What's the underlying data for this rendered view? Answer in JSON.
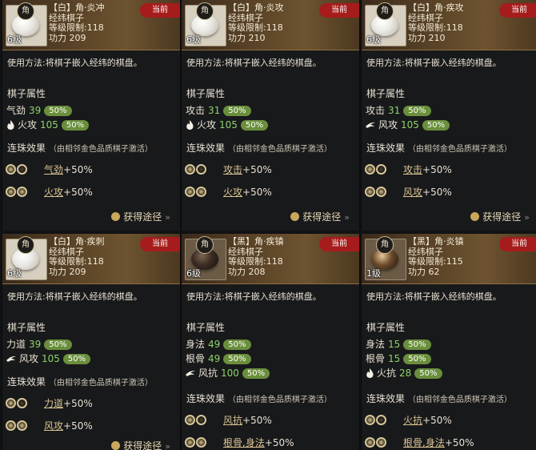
{
  "cards": [
    {
      "tag": "角",
      "level": "6级",
      "name": "【白】角·炎冲",
      "type": "经纬棋子",
      "level_limit": "等级限制:118",
      "power": "功力 209",
      "current": "当前",
      "usage": "使用方法:将棋子嵌入经纬的棋盘。",
      "attr_title": "棋子属性",
      "attrs": [
        {
          "name": "气劲",
          "value": "39",
          "pct": "50%",
          "icon": "none"
        },
        {
          "name": "火攻",
          "value": "105",
          "pct": "50%",
          "icon": "fire-icon"
        }
      ],
      "chain_title": "连珠效果",
      "chain_note": "（由相邻金色品质棋子激活）",
      "chains": [
        {
          "key": "气劲",
          "text": "+50%"
        },
        {
          "key": "火攻",
          "text": "+50%"
        }
      ],
      "get": "获得途径"
    },
    {
      "tag": "角",
      "level": "6级",
      "name": "【白】角·炎攻",
      "type": "经纬棋子",
      "level_limit": "等级限制:118",
      "power": "功力 210",
      "current": "当前",
      "usage": "使用方法:将棋子嵌入经纬的棋盘。",
      "attr_title": "棋子属性",
      "attrs": [
        {
          "name": "攻击",
          "value": "31",
          "pct": "50%",
          "icon": "none"
        },
        {
          "name": "火攻",
          "value": "105",
          "pct": "50%",
          "icon": "fire-icon"
        }
      ],
      "chain_title": "连珠效果",
      "chain_note": "（由相邻金色品质棋子激活）",
      "chains": [
        {
          "key": "攻击",
          "text": "+50%"
        },
        {
          "key": "火攻",
          "text": "+50%"
        }
      ],
      "get": "获得途径"
    },
    {
      "tag": "角",
      "level": "6级",
      "name": "【白】角·疾攻",
      "type": "经纬棋子",
      "level_limit": "等级限制:118",
      "power": "功力 210",
      "current": "当前",
      "usage": "使用方法:将棋子嵌入经纬的棋盘。",
      "attr_title": "棋子属性",
      "attrs": [
        {
          "name": "攻击",
          "value": "31",
          "pct": "50%",
          "icon": "none"
        },
        {
          "name": "风攻",
          "value": "105",
          "pct": "50%",
          "icon": "wind-icon"
        }
      ],
      "chain_title": "连珠效果",
      "chain_note": "（由相邻金色品质棋子激活）",
      "chains": [
        {
          "key": "攻击",
          "text": "+50%"
        },
        {
          "key": "风攻",
          "text": "+50%"
        }
      ],
      "get": "获得途径"
    },
    {
      "tag": "角",
      "level": "6级",
      "name": "【白】角·疾刺",
      "type": "经纬棋子",
      "level_limit": "等级限制:118",
      "power": "功力 209",
      "current": "当前",
      "usage": "使用方法:将棋子嵌入经纬的棋盘。",
      "attr_title": "棋子属性",
      "attrs": [
        {
          "name": "力道",
          "value": "39",
          "pct": "50%",
          "icon": "none"
        },
        {
          "name": "风攻",
          "value": "105",
          "pct": "50%",
          "icon": "wind-icon"
        }
      ],
      "chain_title": "连珠效果",
      "chain_note": "（由相邻金色品质棋子激活）",
      "chains": [
        {
          "key": "力道",
          "text": "+50%"
        },
        {
          "key": "风攻",
          "text": "+50%"
        }
      ],
      "get": "获得途径"
    },
    {
      "tag": "角",
      "level": "6级",
      "name": "【黑】角·疾镇",
      "type": "经纬棋子",
      "level_limit": "等级限制:118",
      "power": "功力 208",
      "current": "当前",
      "usage": "使用方法:将棋子嵌入经纬的棋盘。",
      "attr_title": "棋子属性",
      "attrs": [
        {
          "name": "身法",
          "value": "49",
          "pct": "50%",
          "icon": "none"
        },
        {
          "name": "根骨",
          "value": "49",
          "pct": "50%",
          "icon": "none"
        },
        {
          "name": "风抗",
          "value": "100",
          "pct": "50%",
          "icon": "wind-icon"
        }
      ],
      "chain_title": "连珠效果",
      "chain_note": "（由相邻金色品质棋子激活）",
      "chains": [
        {
          "key": "风抗",
          "text": "+50%"
        },
        {
          "key": "根骨,身法",
          "text": "+50%"
        }
      ],
      "get": ""
    },
    {
      "tag": "角",
      "level": "1级",
      "name": "【黑】角·炎镇",
      "type": "经纬棋子",
      "level_limit": "等级限制:115",
      "power": "功力 62",
      "current": "当前",
      "usage": "使用方法:将棋子嵌入经纬的棋盘。",
      "attr_title": "棋子属性",
      "attrs": [
        {
          "name": "身法",
          "value": "15",
          "pct": "50%",
          "icon": "none"
        },
        {
          "name": "根骨",
          "value": "15",
          "pct": "50%",
          "icon": "none"
        },
        {
          "name": "火抗",
          "value": "28",
          "pct": "50%",
          "icon": "fire-icon"
        }
      ],
      "chain_title": "连珠效果",
      "chain_note": "（由相邻金色品质棋子激活）",
      "chains": [
        {
          "key": "火抗",
          "text": "+50%"
        },
        {
          "key": "根骨,身法",
          "text": "+50%"
        }
      ],
      "get": ""
    }
  ]
}
